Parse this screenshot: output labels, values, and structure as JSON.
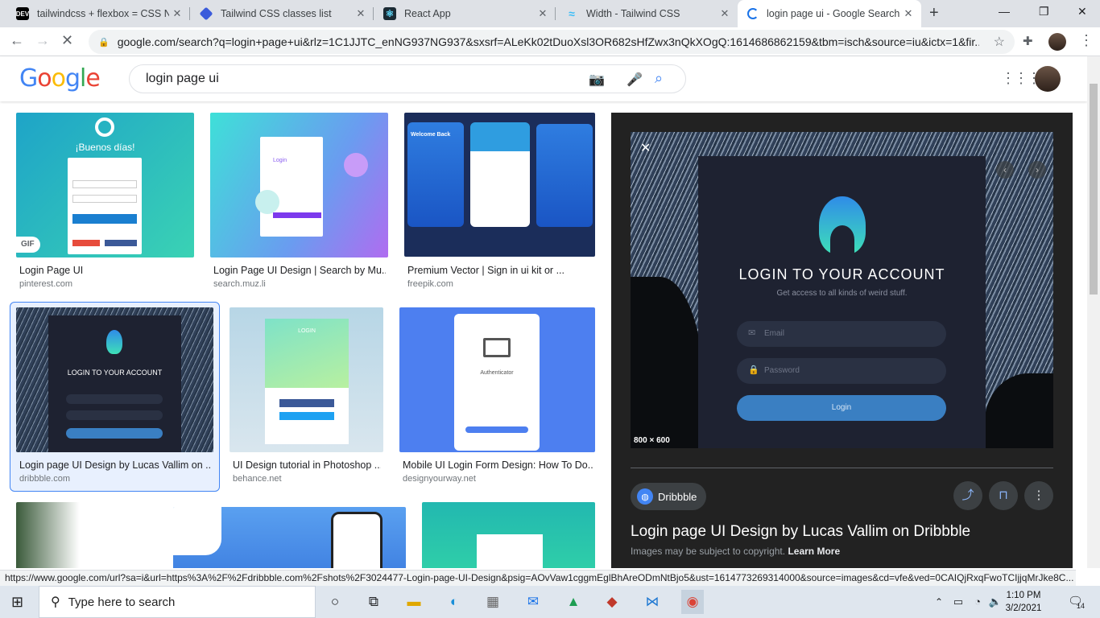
{
  "tabs": [
    {
      "icon": "dev-icon",
      "favtext": "DEV",
      "title": "tailwindcss + flexbox = CSS Ni",
      "color": "#000"
    },
    {
      "icon": "stack-icon",
      "favtext": "",
      "title": "Tailwind CSS classes list",
      "color": "#3b5bdb"
    },
    {
      "icon": "react-icon",
      "favtext": "",
      "title": "React App",
      "color": "#1b2b34"
    },
    {
      "icon": "tailwind-icon",
      "favtext": "",
      "title": "Width - Tailwind CSS",
      "color": "#38bdf8"
    },
    {
      "icon": "loading-icon",
      "favtext": "",
      "title": "login page ui - Google Search",
      "color": "#1a73e8"
    }
  ],
  "address": {
    "url": "google.com/search?q=login+page+ui&rlz=1C1JJTC_enNG937NG937&sxsrf=ALeKk02tDuoXsl3OR682sHfZwx3nQkXOgQ:1614686862159&tbm=isch&source=iu&ictx=1&fir..."
  },
  "google": {
    "logo": "Google",
    "query": "login page ui"
  },
  "results": [
    {
      "caption": "Login Page UI",
      "source": "pinterest.com",
      "gif": "GIF",
      "text": "¡Buenos días!"
    },
    {
      "caption": "Login Page UI Design | Search by Mu...",
      "source": "search.muz.li",
      "text": "Login"
    },
    {
      "caption": "Premium Vector | Sign in ui kit or ...",
      "source": "freepik.com",
      "text": "Welcome Back"
    },
    {
      "caption": "Login page UI Design by Lucas Vallim on ...",
      "source": "dribbble.com",
      "text": "LOGIN TO YOUR ACCOUNT"
    },
    {
      "caption": "UI Design tutorial in Photoshop ...",
      "source": "behance.net",
      "text": "LOGIN"
    },
    {
      "caption": "Mobile UI Login Form Design: How To Do...",
      "source": "designyourway.net",
      "text": "Authenticator"
    }
  ],
  "panel": {
    "card_title": "LOGIN TO YOUR ACCOUNT",
    "card_subtitle": "Get access to all kinds of weird stuff.",
    "email_placeholder": "Email",
    "password_placeholder": "Password",
    "login_button": "Login",
    "dimensions": "800 × 600",
    "source": "Dribbble",
    "title": "Login page UI Design by Lucas Vallim on Dribbble",
    "copyright": "Images may be subject to copyright.",
    "learn_more": "Learn More"
  },
  "status_url": "https://www.google.com/url?sa=i&url=https%3A%2F%2Fdribbble.com%2Fshots%2F3024477-Login-page-UI-Design&psig=AOvVaw1cggmEglBhAreODmNtBjo5&ust=1614773269314000&source=images&cd=vfe&ved=0CAIQjRxqFwoTCIjjqMrJke8C...",
  "taskbar": {
    "search_placeholder": "Type here to search",
    "time": "1:10 PM",
    "date": "3/2/2021",
    "notifications": "14"
  }
}
